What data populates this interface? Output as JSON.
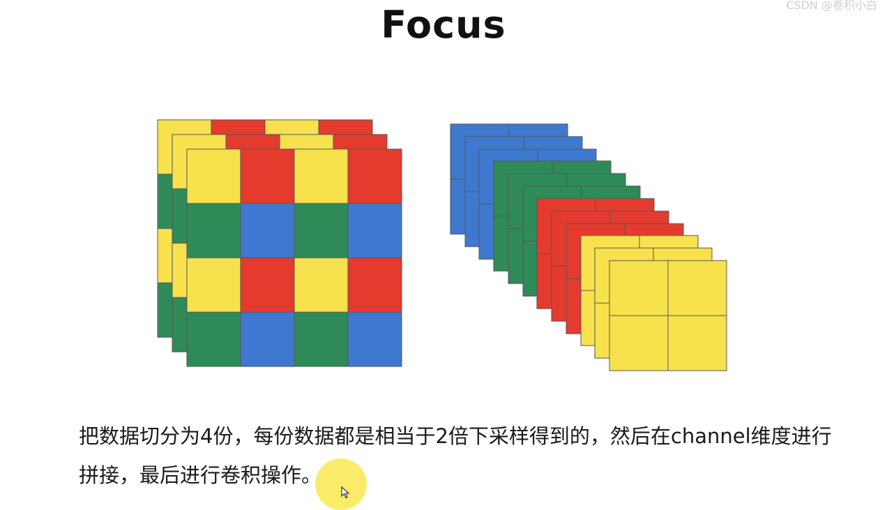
{
  "title": "Focus",
  "caption": {
    "line1": "把数据切分为4份，每份数据都是相当于2倍下采样得到的，然后在channel维度进行",
    "line2": "拼接，最后进行卷积操作。"
  },
  "watermark": "CSDN @卷积小白",
  "colors": {
    "yellow": "#F7E14D",
    "red": "#E53A2E",
    "green": "#2E8B57",
    "blue": "#3E79CF",
    "edge": "#555555",
    "highlight": "#FAE850"
  },
  "input_pattern": [
    [
      "yellow",
      "red",
      "yellow",
      "red"
    ],
    [
      "green",
      "blue",
      "green",
      "blue"
    ],
    [
      "yellow",
      "red",
      "yellow",
      "red"
    ],
    [
      "green",
      "blue",
      "green",
      "blue"
    ]
  ],
  "output_slice_colors": [
    "blue",
    "blue",
    "blue",
    "green",
    "green",
    "green",
    "red",
    "red",
    "red",
    "yellow",
    "yellow",
    "yellow"
  ]
}
